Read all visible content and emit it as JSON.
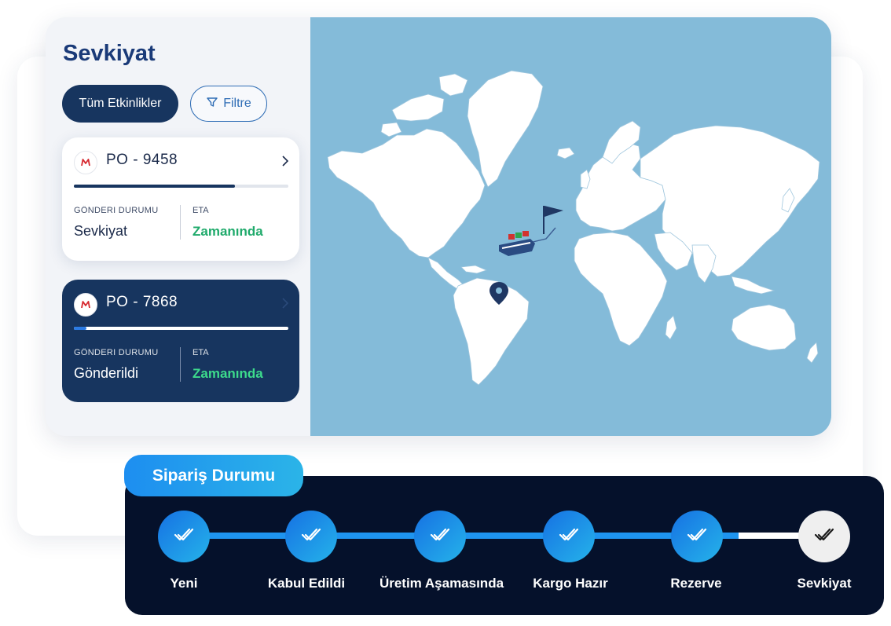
{
  "shipments": {
    "title": "Sevkiyat",
    "all_activities_label": "Tüm Etkinlikler",
    "filter_label": "Filtre",
    "cards": [
      {
        "po": "PO - 9458",
        "progress": 0.75,
        "status_label": "GÖNDERI DURUMU",
        "status": "Sevkiyat",
        "eta_label": "ETA",
        "eta": "Zamanında",
        "selected": false
      },
      {
        "po": "PO - 7868",
        "progress": 0.06,
        "status_label": "GÖNDERI DURUMU",
        "status": "Gönderildi",
        "eta_label": "ETA",
        "eta": "Zamanında",
        "selected": true
      }
    ]
  },
  "map": {
    "markers": [
      "destination-flag",
      "ship",
      "location-pin"
    ]
  },
  "order_status": {
    "title": "Sipariş Durumu",
    "steps": [
      {
        "label": "Yeni",
        "state": "done"
      },
      {
        "label": "Kabul Edildi",
        "state": "done"
      },
      {
        "label": "Üretim Aşamasında",
        "state": "done"
      },
      {
        "label": "Kargo Hazır",
        "state": "done"
      },
      {
        "label": "Rezerve",
        "state": "done"
      },
      {
        "label": "Sevkiyat",
        "state": "current"
      }
    ]
  },
  "colors": {
    "navy": "#17355f",
    "accent_blue": "#1e94ef",
    "eta_green": "#1faa6b",
    "ocean": "#84bbd9",
    "order_panel": "#05112b"
  }
}
